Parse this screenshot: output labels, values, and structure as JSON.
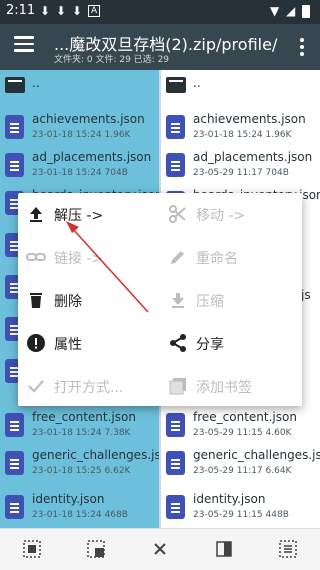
{
  "status": {
    "time": "2:11"
  },
  "header": {
    "path": "...魔改双旦存档(2).zip/profile/",
    "info": "文件夹: 0  文件: 29  已选: 29"
  },
  "left_pane": {
    "parent": "..",
    "files": [
      {
        "name": "achievements.json",
        "meta": "23-01-18 15:24  1.96K"
      },
      {
        "name": "ad_placements.json",
        "meta": "23-01-18 15:24  704B"
      },
      {
        "name": "boards_inventory.json",
        "meta": ""
      },
      {
        "name": "",
        "meta": ""
      },
      {
        "name": "",
        "meta": ""
      },
      {
        "name": "",
        "meta": ""
      },
      {
        "name": "",
        "meta": ""
      },
      {
        "name": "",
        "meta": ""
      },
      {
        "name": "free_content.json",
        "meta": "23-01-18 15:24  7.38K"
      },
      {
        "name": "generic_challenges.json",
        "meta": "23-01-18 15:25  6.62K"
      },
      {
        "name": "identity.json",
        "meta": "23-01-18 15:24  468B"
      }
    ]
  },
  "right_pane": {
    "parent": "..",
    "files": [
      {
        "name": "achievements.json",
        "meta": "23-01-18 15:24  1.96K"
      },
      {
        "name": "ad_placements.json",
        "meta": "23-05-29 11:17  704B"
      },
      {
        "name": "boards_inventory.json",
        "meta": ""
      },
      {
        "name": "",
        "meta": ""
      },
      {
        "name": "",
        "meta": ""
      },
      {
        "name": "js",
        "meta": ""
      },
      {
        "name": "",
        "meta": ""
      },
      {
        "name": "",
        "meta": ""
      },
      {
        "name": "free_content.json",
        "meta": "23-05-29 11:15  4.60K"
      },
      {
        "name": "generic_challenges.json",
        "meta": "23-05-29 11:17  6.64K"
      },
      {
        "name": "identity.json",
        "meta": "23-05-29 11:15  448B"
      }
    ]
  },
  "popup_menu": {
    "extract": "解压 ->",
    "move": "移动 ->",
    "link": "链接 ->",
    "rename": "重命名",
    "delete": "删除",
    "compress": "压缩",
    "properties": "属性",
    "share": "分享",
    "open_with": "打开方式...",
    "add_bookmark": "添加书签"
  },
  "colors": {
    "statusbar": "#263238",
    "appbar": "#37474f",
    "selection": "#6cc0dc",
    "file_icon": "#3f51b5",
    "arrow": "#d32f2f"
  }
}
